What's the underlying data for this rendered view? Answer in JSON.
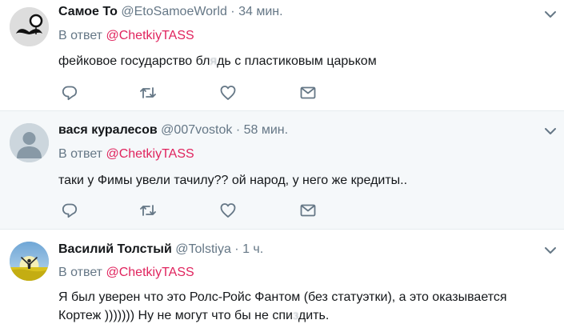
{
  "tweets": [
    {
      "fullname": "Самое То",
      "handle": "@EtoSamoeWorld",
      "separator": "·",
      "time": "34 мин.",
      "reply_prefix": "В ответ",
      "reply_to": "@ChetkiyTASS",
      "text_before": "фейковое государство бл",
      "text_censored": "я",
      "text_after": "дь с пластиковым царьком"
    },
    {
      "fullname": "вася куралесов",
      "handle": "@007vostok",
      "separator": "·",
      "time": "58 мин.",
      "reply_prefix": "В ответ",
      "reply_to": "@ChetkiyTASS",
      "text": "таки у Фимы увели тачилу?? ой народ, у него же кредиты.."
    },
    {
      "fullname": "Василий Толстый",
      "handle": "@Tolstiya",
      "separator": "·",
      "time": "1 ч.",
      "reply_prefix": "В ответ",
      "reply_to": "@ChetkiyTASS",
      "line1": "Я был уверен что это Ролс-Ройс Фантом (без статуэтки), а это оказывается",
      "line2_before": "Кортеж ))))))) Ну не могут что бы не спи",
      "line2_censored": "з",
      "line2_after": "дить."
    }
  ],
  "icons": {
    "reply": "reply-icon",
    "retweet": "retweet-icon",
    "like": "heart-icon",
    "dm": "envelope-icon",
    "menu": "chevron-down-icon"
  },
  "colors": {
    "link": "#e0245e",
    "muted": "#657786",
    "text": "#14171a",
    "highlight_bg": "#f5f8fa"
  }
}
